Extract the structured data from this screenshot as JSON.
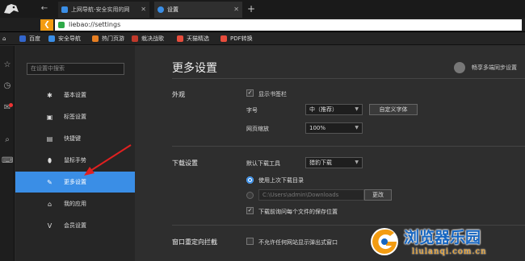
{
  "tabs": [
    {
      "title": "上网导航-安全实用的网",
      "color": "#3a8ee6"
    },
    {
      "title": "设置",
      "color": "#3a8ee6"
    }
  ],
  "new_tab_symbol": "+",
  "address": {
    "url": "liebao://settings"
  },
  "bookmarks": [
    {
      "label": "百度",
      "icon": "baidu-icon",
      "color": "#3366cc"
    },
    {
      "label": "安全导航",
      "icon": "shield-icon",
      "color": "#3a8ee6"
    },
    {
      "label": "热门页游",
      "icon": "game-icon",
      "color": "#e67e22"
    },
    {
      "label": "栽决战歌",
      "icon": "game-icon",
      "color": "#c0392b"
    },
    {
      "label": "天猫精选",
      "icon": "tmall-icon",
      "color": "#e74c3c"
    },
    {
      "label": "PDF转换",
      "icon": "pdf-icon",
      "color": "#e74c3c"
    }
  ],
  "sidebar": {
    "search_placeholder": "在设置中搜索",
    "items": [
      {
        "label": "基本设置",
        "icon": "gear-icon"
      },
      {
        "label": "标签设置",
        "icon": "tab-icon"
      },
      {
        "label": "快捷键",
        "icon": "keyboard-icon"
      },
      {
        "label": "鼠标手势",
        "icon": "mouse-icon"
      },
      {
        "label": "更多设置",
        "icon": "wrench-icon",
        "active": true
      },
      {
        "label": "我的应用",
        "icon": "app-icon"
      },
      {
        "label": "会员设置",
        "icon": "vip-icon"
      }
    ]
  },
  "main": {
    "title": "更多设置",
    "sync_label": "畅享多端同步设置",
    "appearance": {
      "section": "外观",
      "show_bookmarks_label": "显示书签栏",
      "show_bookmarks_checked": true,
      "font_size_label": "字号",
      "font_size_value": "中（推荐）",
      "custom_font_button": "自定义字体",
      "zoom_label": "网页缩放",
      "zoom_value": "100%"
    },
    "downloads": {
      "section": "下载设置",
      "default_tool_label": "默认下载工具",
      "default_tool_value": "猎豹下载",
      "use_last_dir_label": "使用上次下载目录",
      "path_value": "C:\\Users\\admin\\Downloads",
      "change_button": "更改",
      "ask_location_label": "下载前询问每个文件的保存位置",
      "ask_location_checked": true
    },
    "popup": {
      "section": "窗口重定向拦截",
      "block_label": "不允许任何网站显示弹出式窗口"
    }
  },
  "watermark": {
    "title": "浏览器乐园",
    "sub": "liulanqi.com.cn"
  },
  "colors": {
    "accent": "#3a8ee6",
    "back_button": "#f39c12",
    "annotation_arrow": "#e02020"
  }
}
